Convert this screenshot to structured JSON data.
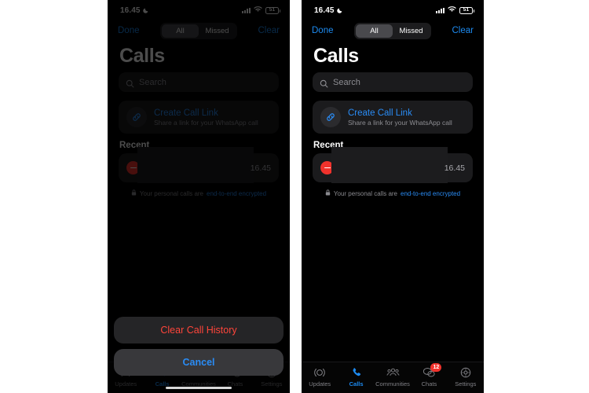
{
  "panels": {
    "left": {
      "name": "calls-screen-with-clear-action-sheet",
      "dimmed": true
    },
    "right": {
      "name": "calls-screen",
      "dimmed": false
    }
  },
  "status_bar": {
    "time": "16.45",
    "moon_icon": "crescent-moon-icon",
    "cellular_icon": "signal-bars-icon",
    "wifi_icon": "wifi-icon",
    "battery_level": "51",
    "battery_icon": "battery-icon"
  },
  "nav": {
    "done_label": "Done",
    "clear_label": "Clear",
    "segments": [
      {
        "label": "All",
        "selected": true
      },
      {
        "label": "Missed",
        "selected": false
      }
    ]
  },
  "header": {
    "title": "Calls"
  },
  "search": {
    "placeholder": "Search",
    "icon": "search-icon"
  },
  "call_link": {
    "icon": "link-icon",
    "title": "Create Call Link",
    "subtitle": "Share a link for your WhatsApp call"
  },
  "recent": {
    "section_label": "Recent",
    "calls": [
      {
        "status_icon": "declined-call-icon",
        "name": "",
        "redacted": true,
        "time": "16.45"
      }
    ]
  },
  "encryption_notice": {
    "icon": "lock-icon",
    "text": "Your personal calls are",
    "link_text": "end-to-end encrypted"
  },
  "tab_bar": {
    "tabs": [
      {
        "label": "Updates",
        "icon": "updates-icon",
        "active": false,
        "badge": ""
      },
      {
        "label": "Calls",
        "icon": "phone-icon",
        "active": true,
        "badge": ""
      },
      {
        "label": "Communities",
        "icon": "communities-icon",
        "active": false,
        "badge": ""
      },
      {
        "label": "Chats",
        "icon": "chats-icon",
        "active": false,
        "badge": "12"
      },
      {
        "label": "Settings",
        "icon": "gear-icon",
        "active": false,
        "badge": ""
      }
    ]
  },
  "action_sheet": {
    "destructive_label": "Clear Call History",
    "cancel_label": "Cancel"
  },
  "colors": {
    "accent_blue": "#1d8bf1",
    "destructive_red": "#ff453a",
    "badge_red": "#f0322c",
    "background": "#000000",
    "card": "#1b1b1d"
  }
}
